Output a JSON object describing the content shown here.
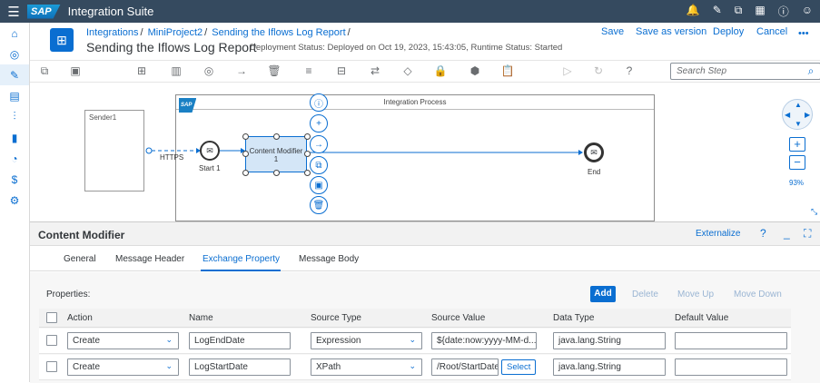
{
  "shell": {
    "logo": "SAP",
    "title": "Integration Suite",
    "icons": [
      "bell-icon",
      "feedback-icon",
      "copy-icon",
      "apps-icon",
      "help-icon",
      "user-icon"
    ]
  },
  "breadcrumb": {
    "items": [
      "Integrations",
      "MiniProject2",
      "Sending the Iflows Log Report"
    ]
  },
  "page": {
    "title": "Sending the Iflows Log Report",
    "status": "Deployment Status: Deployed on Oct 19, 2023, 15:43:05, Runtime Status: Started"
  },
  "header_actions": {
    "save": "Save",
    "save_version": "Save as version",
    "deploy": "Deploy",
    "cancel": "Cancel",
    "more": "•••"
  },
  "toolbar": {
    "search_placeholder": "Search Step"
  },
  "canvas": {
    "sender": "Sender1",
    "https": "HTTPS",
    "start": "Start 1",
    "end": "End",
    "process": "Integration Process",
    "cm_line1": "Content Modifier",
    "cm_line2": "1",
    "zoom": "93%",
    "sap_small": "SAP"
  },
  "panel": {
    "title": "Content Modifier",
    "externalize": "Externalize",
    "tabs": [
      "General",
      "Message Header",
      "Exchange Property",
      "Message Body"
    ],
    "properties_label": "Properties:",
    "buttons": {
      "add": "Add",
      "delete": "Delete",
      "move_up": "Move Up",
      "move_down": "Move Down"
    },
    "columns": [
      "Action",
      "Name",
      "Source Type",
      "Source Value",
      "Data Type",
      "Default Value"
    ],
    "rows": [
      {
        "action": "Create",
        "name": "LogEndDate",
        "source_type": "Expression",
        "source_value": "${date:now:yyyy-MM-d...",
        "data_type": "java.lang.String",
        "default": ""
      },
      {
        "action": "Create",
        "name": "LogStartDate",
        "source_type": "XPath",
        "source_value": "/Root/StartDate",
        "select": "Select",
        "data_type": "java.lang.String",
        "default": ""
      }
    ]
  }
}
